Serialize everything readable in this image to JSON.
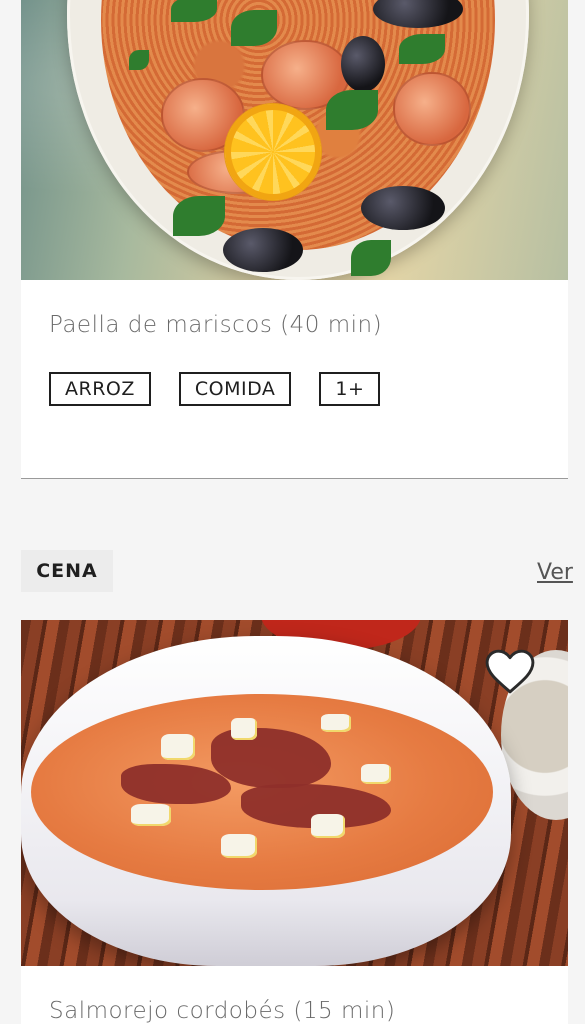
{
  "cards": [
    {
      "title": "Paella de mariscos (40 min)",
      "tags": [
        "ARROZ",
        "COMIDA",
        "1+"
      ]
    },
    {
      "title": "Salmorejo cordobés (15 min)"
    }
  ],
  "section": {
    "label": "CENA",
    "see_all": "Ver"
  },
  "icons": {
    "favorite": "heart-outline-icon"
  },
  "colors": {
    "background": "#f5f5f5",
    "card": "#ffffff",
    "text": "#1f1f1f",
    "muted": "#6a6a6a"
  }
}
